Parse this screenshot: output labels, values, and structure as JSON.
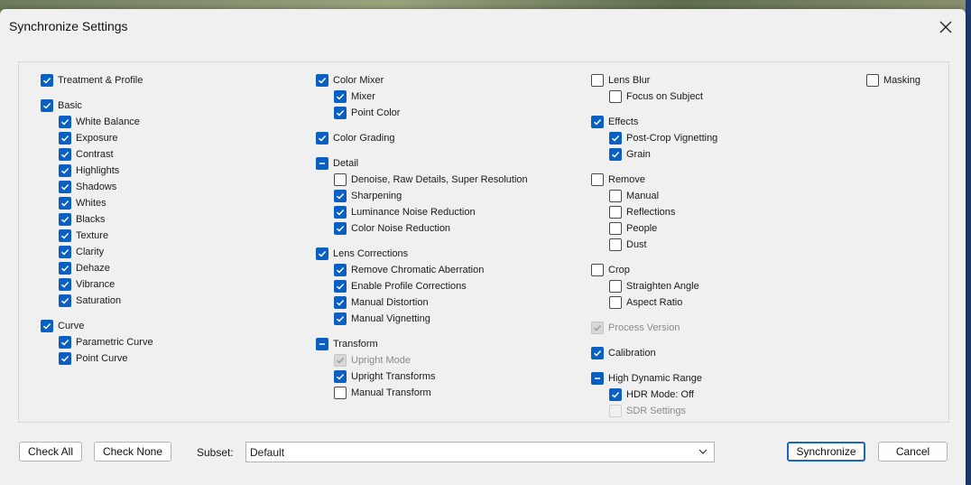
{
  "dialog": {
    "title": "Synchronize Settings"
  },
  "columns": [
    [
      {
        "label": "Treatment & Profile",
        "state": "on",
        "level": 0
      },
      {
        "label": "Basic",
        "state": "on",
        "level": 0,
        "gap": true
      },
      {
        "label": "White Balance",
        "state": "on",
        "level": 1
      },
      {
        "label": "Exposure",
        "state": "on",
        "level": 1
      },
      {
        "label": "Contrast",
        "state": "on",
        "level": 1
      },
      {
        "label": "Highlights",
        "state": "on",
        "level": 1
      },
      {
        "label": "Shadows",
        "state": "on",
        "level": 1
      },
      {
        "label": "Whites",
        "state": "on",
        "level": 1
      },
      {
        "label": "Blacks",
        "state": "on",
        "level": 1
      },
      {
        "label": "Texture",
        "state": "on",
        "level": 1
      },
      {
        "label": "Clarity",
        "state": "on",
        "level": 1
      },
      {
        "label": "Dehaze",
        "state": "on",
        "level": 1
      },
      {
        "label": "Vibrance",
        "state": "on",
        "level": 1
      },
      {
        "label": "Saturation",
        "state": "on",
        "level": 1
      },
      {
        "label": "Curve",
        "state": "on",
        "level": 0,
        "gap": true
      },
      {
        "label": "Parametric Curve",
        "state": "on",
        "level": 1
      },
      {
        "label": "Point Curve",
        "state": "on",
        "level": 1
      }
    ],
    [
      {
        "label": "Color Mixer",
        "state": "on",
        "level": 0
      },
      {
        "label": "Mixer",
        "state": "on",
        "level": 1
      },
      {
        "label": "Point Color",
        "state": "on",
        "level": 1
      },
      {
        "label": "Color Grading",
        "state": "on",
        "level": 0,
        "gap": true
      },
      {
        "label": "Detail",
        "state": "mixed",
        "level": 0,
        "gap": true
      },
      {
        "label": "Denoise, Raw Details, Super Resolution",
        "state": "off",
        "level": 1
      },
      {
        "label": "Sharpening",
        "state": "on",
        "level": 1
      },
      {
        "label": "Luminance Noise Reduction",
        "state": "on",
        "level": 1
      },
      {
        "label": "Color Noise Reduction",
        "state": "on",
        "level": 1
      },
      {
        "label": "Lens Corrections",
        "state": "on",
        "level": 0,
        "gap": true
      },
      {
        "label": "Remove Chromatic Aberration",
        "state": "on",
        "level": 1
      },
      {
        "label": "Enable Profile Corrections",
        "state": "on",
        "level": 1
      },
      {
        "label": "Manual Distortion",
        "state": "on",
        "level": 1
      },
      {
        "label": "Manual Vignetting",
        "state": "on",
        "level": 1
      },
      {
        "label": "Transform",
        "state": "mixed",
        "level": 0,
        "gap": true
      },
      {
        "label": "Upright Mode",
        "state": "disabled-on",
        "level": 1
      },
      {
        "label": "Upright Transforms",
        "state": "on",
        "level": 1
      },
      {
        "label": "Manual Transform",
        "state": "off",
        "level": 1
      }
    ],
    [
      {
        "label": "Lens Blur",
        "state": "off",
        "level": 0
      },
      {
        "label": "Focus on Subject",
        "state": "off",
        "level": 1
      },
      {
        "label": "Effects",
        "state": "on",
        "level": 0,
        "gap": true
      },
      {
        "label": "Post-Crop Vignetting",
        "state": "on",
        "level": 1
      },
      {
        "label": "Grain",
        "state": "on",
        "level": 1
      },
      {
        "label": "Remove",
        "state": "off",
        "level": 0,
        "gap": true
      },
      {
        "label": "Manual",
        "state": "off",
        "level": 1
      },
      {
        "label": "Reflections",
        "state": "off",
        "level": 1
      },
      {
        "label": "People",
        "state": "off",
        "level": 1
      },
      {
        "label": "Dust",
        "state": "off",
        "level": 1
      },
      {
        "label": "Crop",
        "state": "off",
        "level": 0,
        "gap": true
      },
      {
        "label": "Straighten Angle",
        "state": "off",
        "level": 1
      },
      {
        "label": "Aspect Ratio",
        "state": "off",
        "level": 1
      },
      {
        "label": "Process Version",
        "state": "disabled-on",
        "level": 0,
        "gap": true
      },
      {
        "label": "Calibration",
        "state": "on",
        "level": 0,
        "gap": true
      },
      {
        "label": "High Dynamic Range",
        "state": "mixed",
        "level": 0,
        "gap": true
      },
      {
        "label": "HDR Mode: Off",
        "state": "on",
        "level": 1
      },
      {
        "label": "SDR Settings",
        "state": "disabled-off",
        "level": 1
      }
    ],
    [
      {
        "label": "Masking",
        "state": "off",
        "level": 0
      }
    ]
  ],
  "footer": {
    "check_all": "Check All",
    "check_none": "Check None",
    "subset_label": "Subset:",
    "subset_value": "Default",
    "synchronize": "Synchronize",
    "cancel": "Cancel"
  },
  "colors": {
    "accent": "#0a5fc2"
  }
}
